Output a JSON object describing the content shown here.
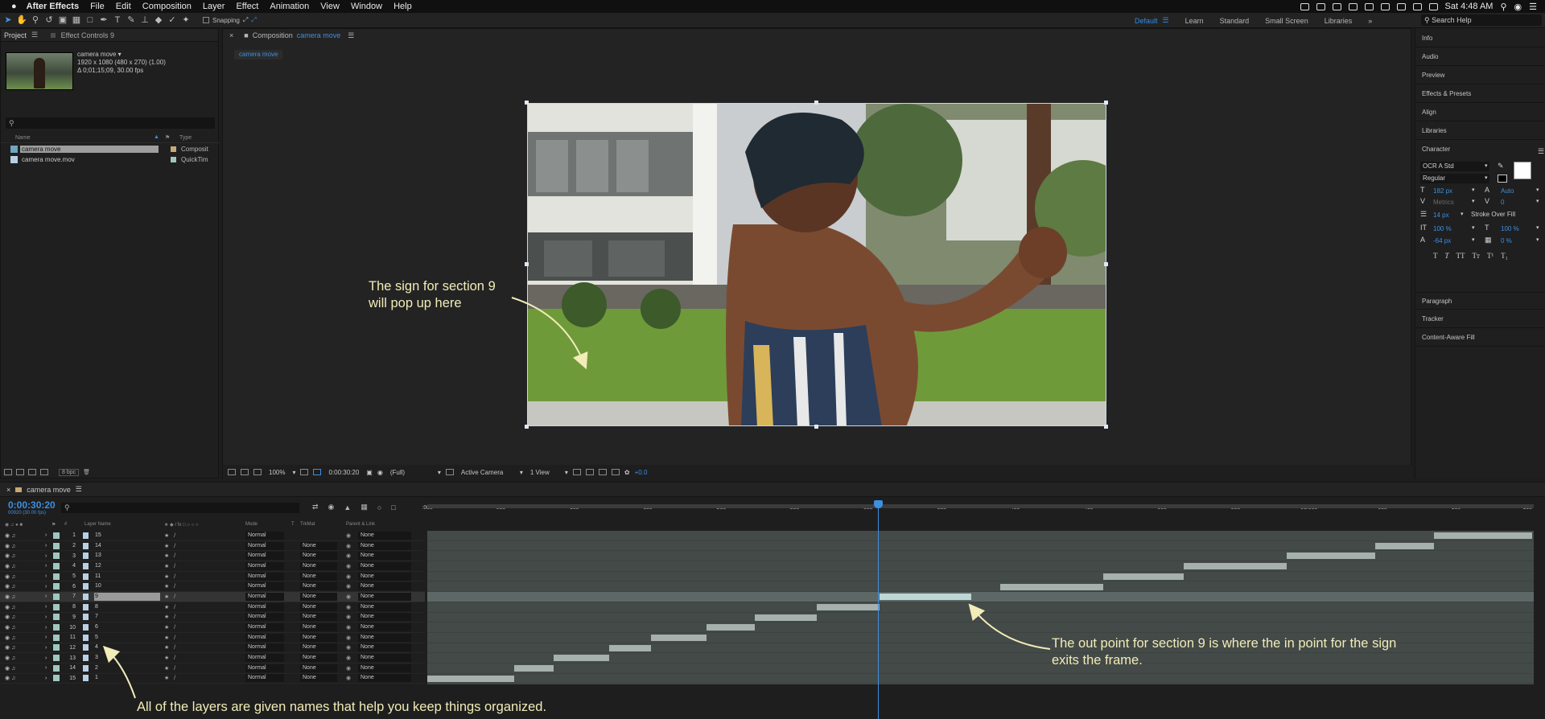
{
  "menubar": {
    "apple": "",
    "app_name": "After Effects",
    "items": [
      "File",
      "Edit",
      "Composition",
      "Layer",
      "Effect",
      "Animation",
      "View",
      "Window",
      "Help"
    ],
    "clock": "Sat 4:48 AM"
  },
  "toolbar": {
    "snapping_label": "Snapping"
  },
  "workspaces": {
    "items": [
      "Default",
      "Learn",
      "Standard",
      "Small Screen",
      "Libraries"
    ],
    "active": "Default",
    "search_placeholder": "Search Help"
  },
  "project": {
    "tab_project": "Project",
    "tab_effects": "Effect Controls 9",
    "item_name": "camera move ▾",
    "item_res": "1920 x 1080  (480 x 270) (1.00)",
    "item_dur": "Δ 0;01;15;09, 30.00 fps",
    "search_value": "",
    "col_name": "Name",
    "col_type": "Type",
    "rows": [
      {
        "name": "camera move",
        "type": "Composit",
        "color": "#c8a874"
      },
      {
        "name": "camera move.mov",
        "type": "QuickTim",
        "color": "#9fc6bf"
      }
    ],
    "bpc": "8 bpc"
  },
  "composition": {
    "tab_prefix": "Composition",
    "tab_name": "camera move",
    "crumb": "camera move",
    "footer": {
      "zoom": "100%",
      "timecode": "0:00:30:20",
      "resolution": "(Full)",
      "camera": "Active Camera",
      "views": "1 View",
      "exposure": "+0.0"
    }
  },
  "right_panels": {
    "items": [
      "Info",
      "Audio",
      "Preview",
      "Effects & Presets",
      "Align",
      "Libraries"
    ],
    "character": {
      "title": "Character",
      "font": "OCR A Std",
      "style": "Regular",
      "size": "182 px",
      "leading": "Auto",
      "kerning": "Metrics",
      "tracking": "0",
      "stroke_width": "14 px",
      "stroke_type": "Stroke Over Fill",
      "vscale": "100 %",
      "hscale": "100 %",
      "baseline": "-64 px",
      "tsume": "0 %"
    },
    "bottom_items": [
      "Paragraph",
      "Tracker",
      "Content-Aware Fill"
    ]
  },
  "timeline": {
    "tab_name": "camera move",
    "timecode": "0:00:30:20",
    "fps": "00920 (30.00 fps)",
    "search_value": "",
    "col_labels": {
      "num": "#",
      "name": "Layer Name",
      "mode": "Mode",
      "t": "T",
      "trkmat": "TrkMat",
      "parent": "Parent & Link"
    },
    "ruler_labels": [
      ":00s",
      "05s",
      "10s",
      "15s",
      "20s",
      "25s",
      "30s",
      "35s",
      "40s",
      "45s",
      "50s",
      "55s",
      "01:00s",
      "05s",
      "10s",
      "15s"
    ],
    "layers": [
      {
        "idx": "1",
        "name": "15",
        "mode": "Normal",
        "trkmat": "",
        "parent": "None"
      },
      {
        "idx": "2",
        "name": "14",
        "mode": "Normal",
        "trkmat": "None",
        "parent": "None"
      },
      {
        "idx": "3",
        "name": "13",
        "mode": "Normal",
        "trkmat": "None",
        "parent": "None"
      },
      {
        "idx": "4",
        "name": "12",
        "mode": "Normal",
        "trkmat": "None",
        "parent": "None"
      },
      {
        "idx": "5",
        "name": "11",
        "mode": "Normal",
        "trkmat": "None",
        "parent": "None"
      },
      {
        "idx": "6",
        "name": "10",
        "mode": "Normal",
        "trkmat": "None",
        "parent": "None"
      },
      {
        "idx": "7",
        "name": "9",
        "mode": "Normal",
        "trkmat": "None",
        "parent": "None"
      },
      {
        "idx": "8",
        "name": "8",
        "mode": "Normal",
        "trkmat": "None",
        "parent": "None"
      },
      {
        "idx": "9",
        "name": "7",
        "mode": "Normal",
        "trkmat": "None",
        "parent": "None"
      },
      {
        "idx": "10",
        "name": "6",
        "mode": "Normal",
        "trkmat": "None",
        "parent": "None"
      },
      {
        "idx": "11",
        "name": "5",
        "mode": "Normal",
        "trkmat": "None",
        "parent": "None"
      },
      {
        "idx": "12",
        "name": "4",
        "mode": "Normal",
        "trkmat": "None",
        "parent": "None"
      },
      {
        "idx": "13",
        "name": "3",
        "mode": "Normal",
        "trkmat": "None",
        "parent": "None"
      },
      {
        "idx": "14",
        "name": "2",
        "mode": "Normal",
        "trkmat": "None",
        "parent": "None"
      },
      {
        "idx": "15",
        "name": "1",
        "mode": "Normal",
        "trkmat": "None",
        "parent": "None"
      }
    ],
    "selected_layer_index": 6,
    "layer_spans_seconds": [
      [
        68.5,
        75.2
      ],
      [
        64.5,
        68.5
      ],
      [
        58.5,
        64.5
      ],
      [
        51.5,
        58.5
      ],
      [
        46.0,
        51.5
      ],
      [
        39.0,
        46.0
      ],
      [
        30.8,
        37.0
      ],
      [
        26.5,
        30.8
      ],
      [
        22.3,
        26.5
      ],
      [
        19.0,
        22.3
      ],
      [
        15.2,
        19.0
      ],
      [
        12.4,
        15.2
      ],
      [
        8.6,
        12.4
      ],
      [
        5.9,
        8.6
      ],
      [
        0.0,
        5.9
      ]
    ],
    "timeline_duration_seconds": 75.3,
    "current_time_seconds": 30.67
  },
  "annotations": {
    "section9_popup": "The sign for section 9\nwill pop up here",
    "out_point": "The out point for section 9 is where the in point for the sign\nexits the frame.",
    "layer_names": "All of the layers are given names that help you keep things organized."
  }
}
